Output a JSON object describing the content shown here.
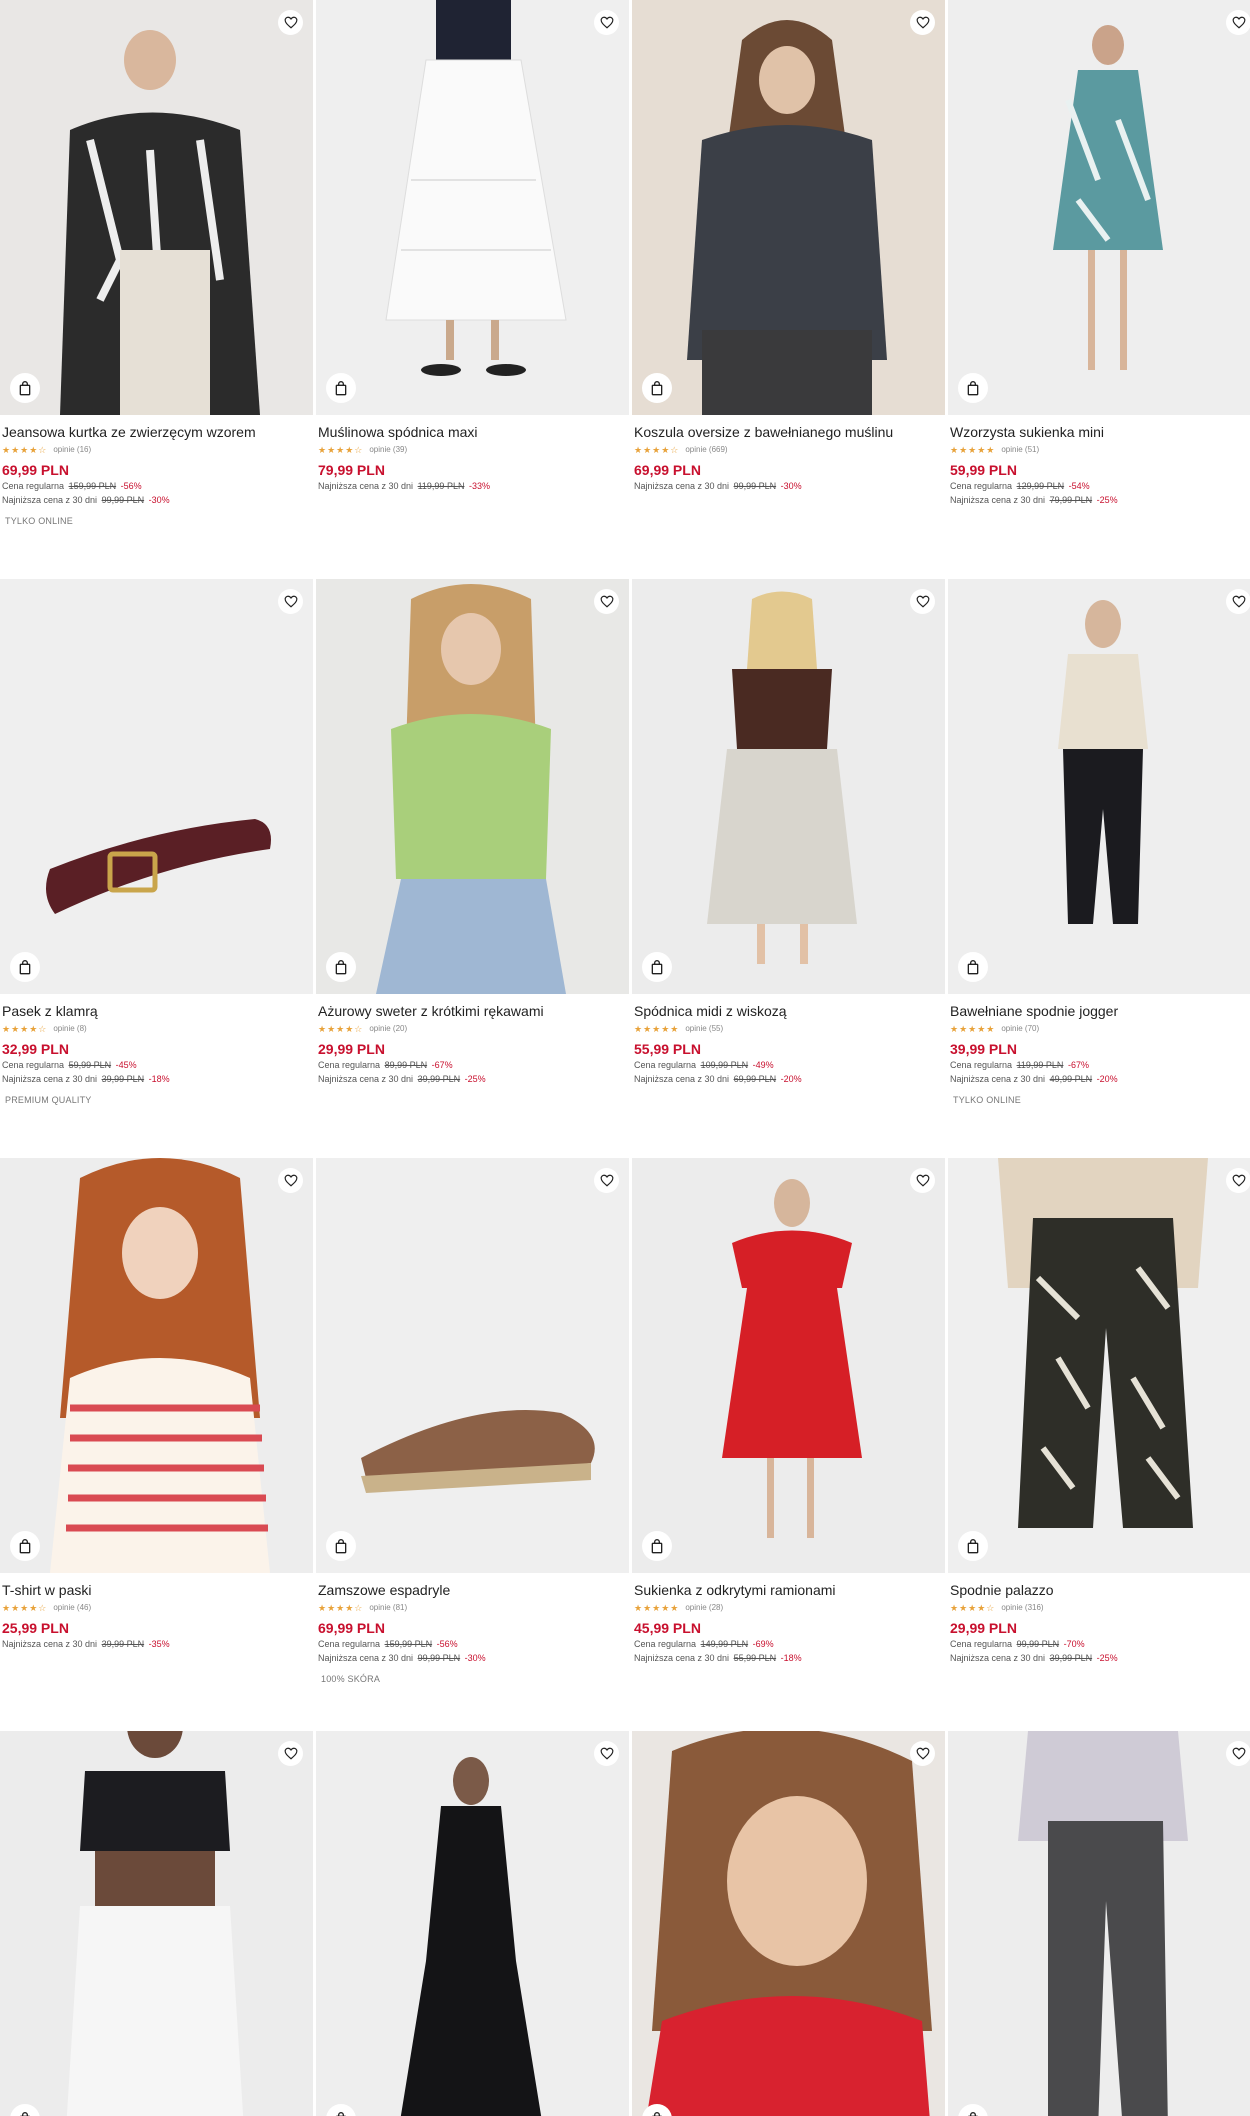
{
  "products": [
    {
      "title": "Jeansowa kurtka ze zwierzęcym wzorem",
      "stars": "★★★★☆",
      "reviews": "opinie (16)",
      "price": "69,99 PLN",
      "regular_label": "Cena regularna",
      "regular_old": "159,99 PLN",
      "regular_pct": "-56%",
      "lowest_label": "Najniższa cena z 30 dni",
      "lowest_old": "99,99 PLN",
      "lowest_pct": "-30%",
      "badge": "TYLKO ONLINE",
      "bg": "#e9e7e5"
    },
    {
      "title": "Muślinowa spódnica maxi",
      "stars": "★★★★☆",
      "reviews": "opinie (39)",
      "price": "79,99 PLN",
      "regular_label": "",
      "regular_old": "",
      "regular_pct": "",
      "lowest_label": "Najniższa cena z 30 dni",
      "lowest_old": "119,99 PLN",
      "lowest_pct": "-33%",
      "badge": "",
      "bg": "#efefef"
    },
    {
      "title": "Koszula oversize z bawełnianego muślinu",
      "stars": "★★★★☆",
      "reviews": "opinie (669)",
      "price": "69,99 PLN",
      "regular_label": "",
      "regular_old": "",
      "regular_pct": "",
      "lowest_label": "Najniższa cena z 30 dni",
      "lowest_old": "99,99 PLN",
      "lowest_pct": "-30%",
      "badge": "",
      "bg": "#e6ddd3"
    },
    {
      "title": "Wzorzysta sukienka mini",
      "stars": "★★★★★",
      "reviews": "opinie (51)",
      "price": "59,99 PLN",
      "regular_label": "Cena regularna",
      "regular_old": "129,99 PLN",
      "regular_pct": "-54%",
      "lowest_label": "Najniższa cena z 30 dni",
      "lowest_old": "79,99 PLN",
      "lowest_pct": "-25%",
      "badge": "",
      "bg": "#eeeeee"
    },
    {
      "title": "Pasek z klamrą",
      "stars": "★★★★☆",
      "reviews": "opinie (8)",
      "price": "32,99 PLN",
      "regular_label": "Cena regularna",
      "regular_old": "59,99 PLN",
      "regular_pct": "-45%",
      "lowest_label": "Najniższa cena z 30 dni",
      "lowest_old": "39,99 PLN",
      "lowest_pct": "-18%",
      "badge": "PREMIUM QUALITY",
      "bg": "#efefef"
    },
    {
      "title": "Ażurowy sweter z krótkimi rękawami",
      "stars": "★★★★☆",
      "reviews": "opinie (20)",
      "price": "29,99 PLN",
      "regular_label": "Cena regularna",
      "regular_old": "89,99 PLN",
      "regular_pct": "-67%",
      "lowest_label": "Najniższa cena z 30 dni",
      "lowest_old": "39,99 PLN",
      "lowest_pct": "-25%",
      "badge": "",
      "bg": "#e8e8e6"
    },
    {
      "title": "Spódnica midi z wiskozą",
      "stars": "★★★★★",
      "reviews": "opinie (55)",
      "price": "55,99 PLN",
      "regular_label": "Cena regularna",
      "regular_old": "109,99 PLN",
      "regular_pct": "-49%",
      "lowest_label": "Najniższa cena z 30 dni",
      "lowest_old": "69,99 PLN",
      "lowest_pct": "-20%",
      "badge": "",
      "bg": "#ececec"
    },
    {
      "title": "Bawełniane spodnie jogger",
      "stars": "★★★★★",
      "reviews": "opinie (70)",
      "price": "39,99 PLN",
      "regular_label": "Cena regularna",
      "regular_old": "119,99 PLN",
      "regular_pct": "-67%",
      "lowest_label": "Najniższa cena z 30 dni",
      "lowest_old": "49,99 PLN",
      "lowest_pct": "-20%",
      "badge": "TYLKO ONLINE",
      "bg": "#eeeeee"
    },
    {
      "title": "T-shirt w paski",
      "stars": "★★★★☆",
      "reviews": "opinie (46)",
      "price": "25,99 PLN",
      "regular_label": "",
      "regular_old": "",
      "regular_pct": "",
      "lowest_label": "Najniższa cena z 30 dni",
      "lowest_old": "39,99 PLN",
      "lowest_pct": "-35%",
      "badge": "",
      "bg": "#ededed"
    },
    {
      "title": "Zamszowe espadryle",
      "stars": "★★★★☆",
      "reviews": "opinie (81)",
      "price": "69,99 PLN",
      "regular_label": "Cena regularna",
      "regular_old": "159,99 PLN",
      "regular_pct": "-56%",
      "lowest_label": "Najniższa cena z 30 dni",
      "lowest_old": "99,99 PLN",
      "lowest_pct": "-30%",
      "badge": "100% SKÓRA",
      "bg": "#efefef"
    },
    {
      "title": "Sukienka z odkrytymi ramionami",
      "stars": "★★★★★",
      "reviews": "opinie (28)",
      "price": "45,99 PLN",
      "regular_label": "Cena regularna",
      "regular_old": "149,99 PLN",
      "regular_pct": "-69%",
      "lowest_label": "Najniższa cena z 30 dni",
      "lowest_old": "55,99 PLN",
      "lowest_pct": "-18%",
      "badge": "",
      "bg": "#ececec"
    },
    {
      "title": "Spodnie palazzo",
      "stars": "★★★★☆",
      "reviews": "opinie (316)",
      "price": "29,99 PLN",
      "regular_label": "Cena regularna",
      "regular_old": "99,99 PLN",
      "regular_pct": "-70%",
      "lowest_label": "Najniższa cena z 30 dni",
      "lowest_old": "39,99 PLN",
      "lowest_pct": "-25%",
      "badge": "",
      "bg": "#efefef"
    },
    {
      "title": "",
      "stars": "",
      "reviews": "",
      "price": "",
      "regular_label": "",
      "regular_old": "",
      "regular_pct": "",
      "lowest_label": "",
      "lowest_old": "",
      "lowest_pct": "",
      "badge": "",
      "bg": "#ececec"
    },
    {
      "title": "",
      "stars": "",
      "reviews": "",
      "price": "",
      "regular_label": "",
      "regular_old": "",
      "regular_pct": "",
      "lowest_label": "",
      "lowest_old": "",
      "lowest_pct": "",
      "badge": "",
      "bg": "#eeeeee"
    },
    {
      "title": "",
      "stars": "",
      "reviews": "",
      "price": "",
      "regular_label": "",
      "regular_old": "",
      "regular_pct": "",
      "lowest_label": "",
      "lowest_old": "",
      "lowest_pct": "",
      "badge": "",
      "bg": "#eae6e2"
    },
    {
      "title": "",
      "stars": "",
      "reviews": "",
      "price": "",
      "regular_label": "",
      "regular_old": "",
      "regular_pct": "",
      "lowest_label": "",
      "lowest_old": "",
      "lowest_pct": "",
      "badge": "",
      "bg": "#ededed"
    }
  ],
  "icons": {
    "wishlist": "heart-icon",
    "add_to_bag": "bag-icon"
  },
  "colors": {
    "price_red": "#c8102e",
    "star": "#e8a23a",
    "text": "#222222"
  }
}
